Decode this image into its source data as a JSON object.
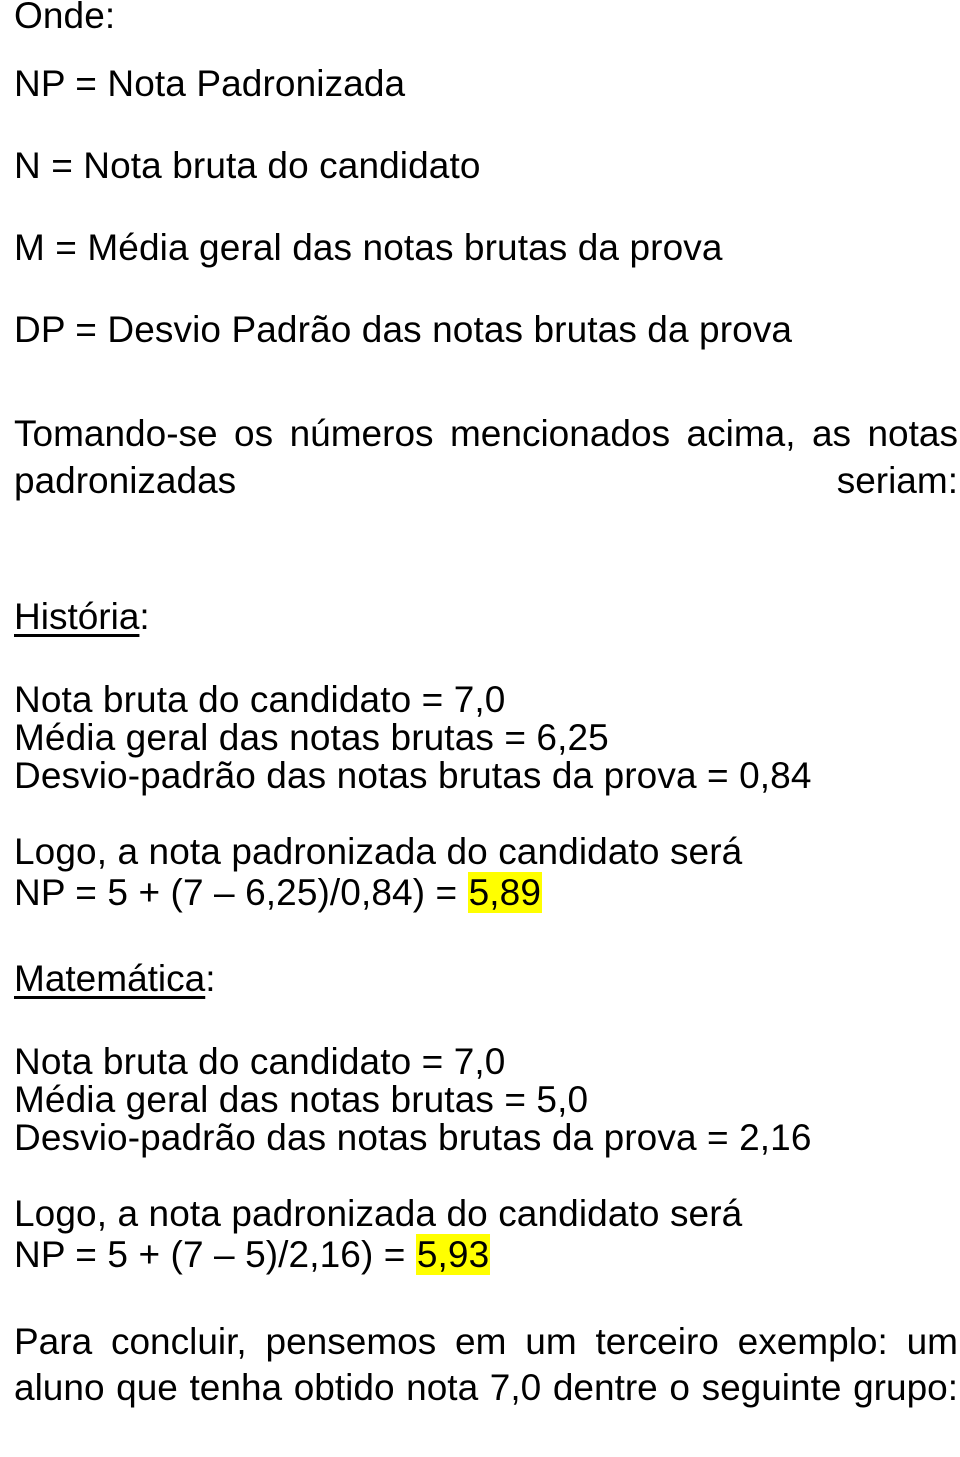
{
  "document": {
    "language": "pt-BR",
    "background_color": "#ffffff",
    "text_color": "#000000",
    "highlight_color": "#ffff00"
  },
  "onde_heading": "Onde:",
  "definitions": [
    "NP = Nota Padronizada",
    "N = Nota bruta do candidato",
    "M = Média geral das notas brutas da prova",
    "DP = Desvio Padrão das notas brutas da prova"
  ],
  "intro_paragraph": "Tomando-se os números mencionados acima, as notas padronizadas seriam:",
  "sections": [
    {
      "heading_text": "História",
      "heading_colon": ":",
      "data_lines": [
        "Nota bruta do candidato = 7,0",
        "Média geral das notas brutas = 6,25",
        "Desvio-padrão das notas brutas da prova = 0,84"
      ],
      "conclusion_label": "Logo, a nota padronizada do candidato será",
      "formula_prefix": "NP = 5 + (7 – 6,25)/0,84) = ",
      "result": "5,89"
    },
    {
      "heading_text": "Matemática",
      "heading_colon": ":",
      "data_lines": [
        "Nota bruta do candidato = 7,0",
        "Média geral das notas brutas = 5,0",
        "Desvio-padrão das notas brutas da prova = 2,16"
      ],
      "conclusion_label": "Logo, a nota padronizada do candidato será",
      "formula_prefix": "NP = 5 + (7 – 5)/2,16) = ",
      "result": "5,93"
    }
  ],
  "final_paragraph": "Para concluir, pensemos em um terceiro exemplo: um aluno que tenha obtido nota 7,0 dentre o seguinte grupo:"
}
